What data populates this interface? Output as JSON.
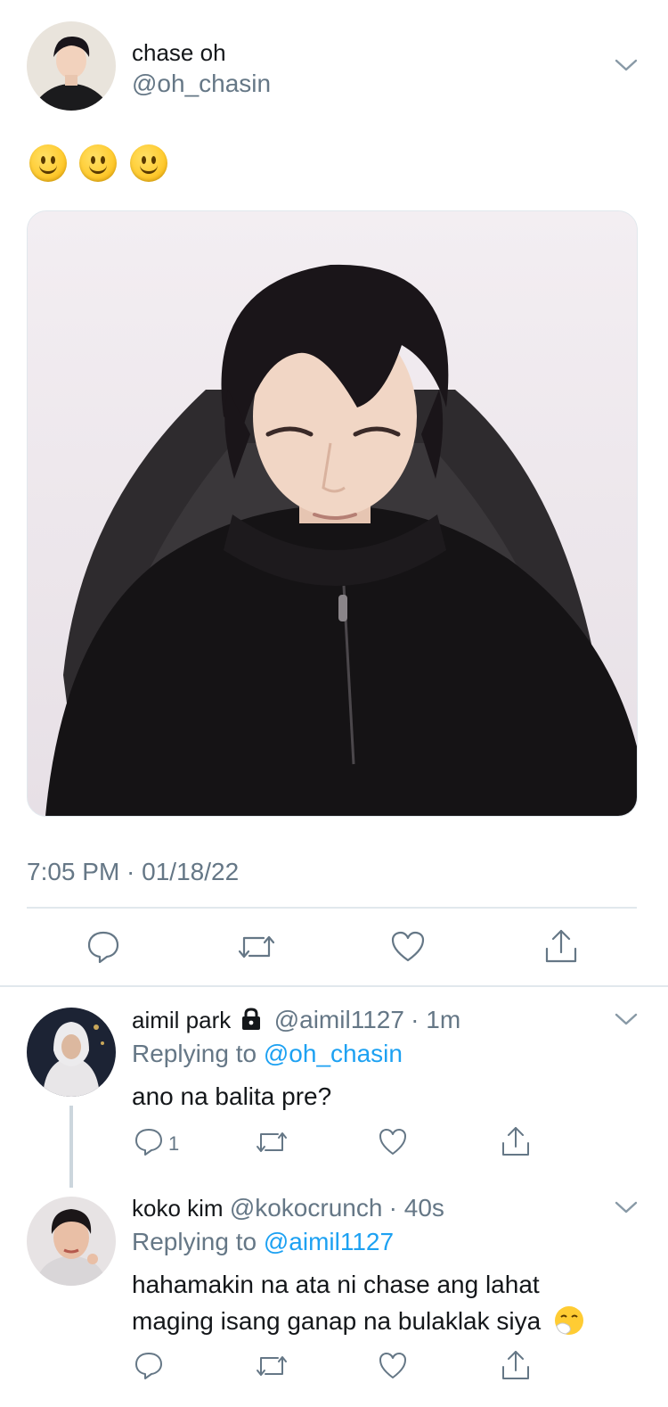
{
  "main_tweet": {
    "display_name": "chase oh",
    "handle": "@oh_chasin",
    "emojis": [
      "slightly-smiling-face",
      "slightly-smiling-face",
      "slightly-smiling-face"
    ],
    "timestamp": "7:05 PM · 01/18/22",
    "actions": [
      "reply-icon",
      "retweet-icon",
      "like-icon",
      "share-icon"
    ]
  },
  "replies": [
    {
      "display_name": "aimil park",
      "protected": true,
      "handle": "@aimil1127",
      "time": "· 1m",
      "replying_prefix": "Replying to ",
      "replying_to": "@oh_chasin",
      "text": "ano na balita pre?",
      "reply_count": "1"
    },
    {
      "display_name": "koko kim",
      "handle": "@kokocrunch",
      "time": "· 40s",
      "replying_prefix": "Replying to ",
      "replying_to": "@aimil1127",
      "text_line1": "hahamakin na ata ni chase ang lahat",
      "text_line2": "maging isang ganap na bulaklak siya",
      "trailing_emoji": "sneezing-face"
    }
  ],
  "colors": {
    "link": "#1da1f2",
    "muted": "#657786",
    "border": "#e1e8ed"
  }
}
